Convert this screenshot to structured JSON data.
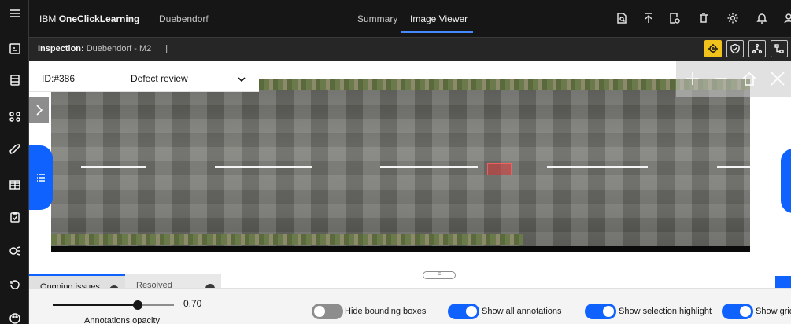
{
  "app": {
    "brand_prefix": "IBM",
    "brand_name": "OneClickLearning",
    "site": "Duebendorf"
  },
  "nav": {
    "tabs": [
      "Summary",
      "Image Viewer"
    ],
    "active_tab": "Image Viewer"
  },
  "header_icons": [
    "report-search-icon",
    "upload-icon",
    "document-time-icon",
    "trash-icon",
    "settings-icon",
    "notification-icon",
    "user-icon"
  ],
  "inspection": {
    "label": "Inspection:",
    "value": "Duebendorf - M2",
    "separator": "|"
  },
  "toolbar": {
    "tools": [
      "target-icon",
      "shield-check-icon",
      "hierarchy-icon",
      "tree-view-icon"
    ],
    "active_tool": "target-icon"
  },
  "viewer": {
    "id": "ID:#386",
    "mode": "Defect review",
    "zoom_controls": [
      "zoom-in-icon",
      "zoom-out-icon",
      "home-icon",
      "fit-icon"
    ]
  },
  "bottom_tabs": [
    {
      "label": "Ongoing issues"
    },
    {
      "label": "Resolved"
    }
  ],
  "panel_handle": "≡",
  "controls": {
    "opacity_label": "Annotations opacity",
    "opacity_value": "0.70",
    "opacity": 0.7,
    "toggles": [
      {
        "label": "Hide bounding boxes",
        "on": false
      },
      {
        "label": "Show all annotations",
        "on": true
      },
      {
        "label": "Show selection highlight",
        "on": true
      },
      {
        "label": "Show grid",
        "on": true
      }
    ]
  },
  "colors": {
    "accent": "#0f62fe",
    "header_bg": "#161616",
    "active_tool": "#f1c21b",
    "defect": "#dc3c3c"
  }
}
